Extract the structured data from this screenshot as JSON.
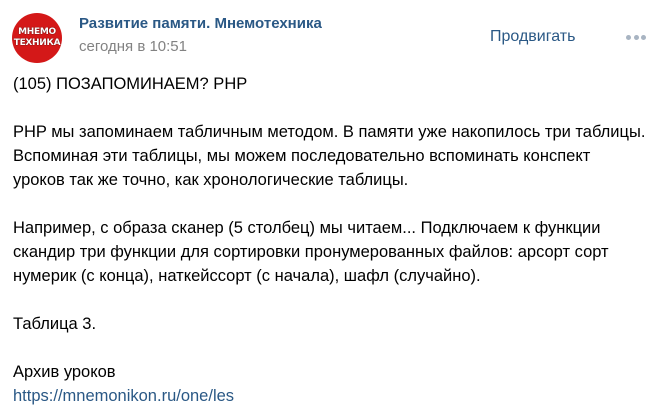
{
  "post": {
    "author": {
      "avatar_lines": [
        "МНЕМО",
        "ТЕХНИКА"
      ],
      "name": "Развитие памяти. Мнемотехника",
      "date": "сегодня в 10:51"
    },
    "actions": {
      "promote_label": "Продвигать",
      "more_icon": "more-horizontal-icon"
    },
    "text": {
      "heading": "(105) ПОЗАПОМИНАЕМ? PHP",
      "paragraph_1": "PHP мы запоминаем табличным методом. В памяти уже накопилось три таблицы.\nВспоминая эти таблицы, мы можем последовательно вспоминать конспект\nуроков так же точно, как хронологические таблицы.",
      "paragraph_2": "Например, с образа сканер (5 столбец) мы читаем... Подключаем к функции\nскандир три функции для сортировки пронумерованных файлов: арсорт сорт\nнумерик (с конца), наткейссорт (с начала), шафл (случайно).",
      "paragraph_3": "Таблица 3.",
      "archive_label": "Архив уроков",
      "archive_link": "https://mnemonikon.ru/one/les"
    }
  },
  "colors": {
    "link": "#2a5885",
    "muted": "#828282",
    "avatar_bg": "#d41818",
    "dots": "#a8b4c2"
  }
}
